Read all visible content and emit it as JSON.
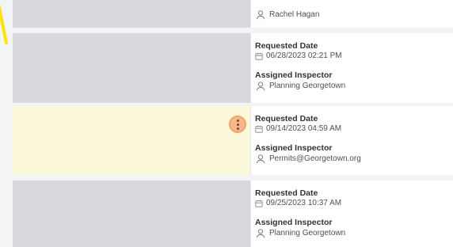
{
  "records": [
    {
      "assigned_inspector": "Rachel Hagan"
    },
    {
      "requested_date_label": "Requested Date",
      "requested_date": "06/28/2023 02:21 PM",
      "assigned_inspector_label": "Assigned Inspector",
      "assigned_inspector": "Planning Georgetown"
    },
    {
      "requested_date_label": "Requested Date",
      "requested_date": "09/14/2023 04:59 AM",
      "assigned_inspector_label": "Assigned Inspector",
      "assigned_inspector": "Permits@Georgetown.org"
    },
    {
      "requested_date_label": "Requested Date",
      "requested_date": "09/25/2023 10:37 AM",
      "assigned_inspector_label": "Assigned Inspector",
      "assigned_inspector": "Planning Georgetown"
    }
  ],
  "icons": {
    "calendar": "calendar-icon",
    "person": "person-icon",
    "more": "more-vertical-icon"
  },
  "colors": {
    "highlight_background": "#fbf7d9",
    "row_left_background": "#d7d9dc",
    "menu_button_fill": "#f6b88a",
    "menu_button_ring": "#f2a46f"
  }
}
